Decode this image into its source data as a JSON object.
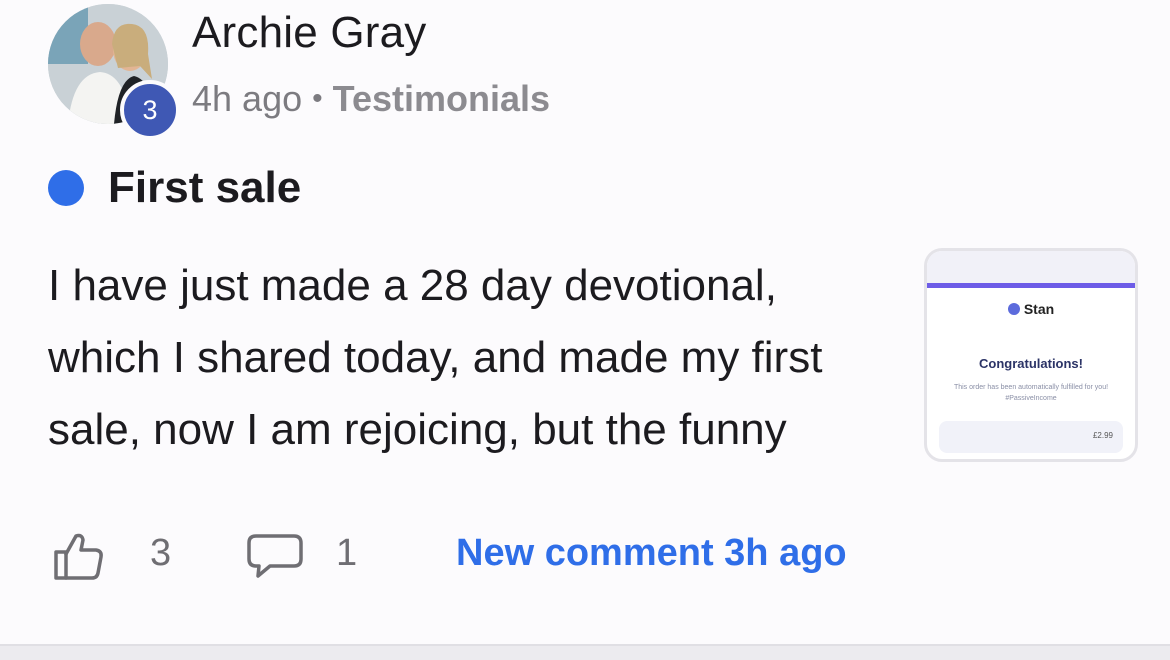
{
  "post": {
    "author": "Archie Gray",
    "level": "3",
    "time": "4h ago",
    "separator": "•",
    "category": "Testimonials",
    "title": "First sale",
    "body_lines": [
      "I have just made a 28 day devotional,",
      "which I shared today, and made my first",
      "sale, now I am rejoicing, but the funny"
    ],
    "thumbnail": {
      "brand": "Stan",
      "heading": "Congratulations!",
      "text": "This order has been automatically fulfilled for you! #PassiveIncome",
      "price": "£2.99"
    }
  },
  "footer": {
    "like_count": "3",
    "comment_count": "1",
    "new_comment": "New comment 3h ago"
  },
  "colors": {
    "accent": "#2f6ee8",
    "level_badge": "#3f58b4",
    "thumb_accent": "#6d5ce7"
  }
}
